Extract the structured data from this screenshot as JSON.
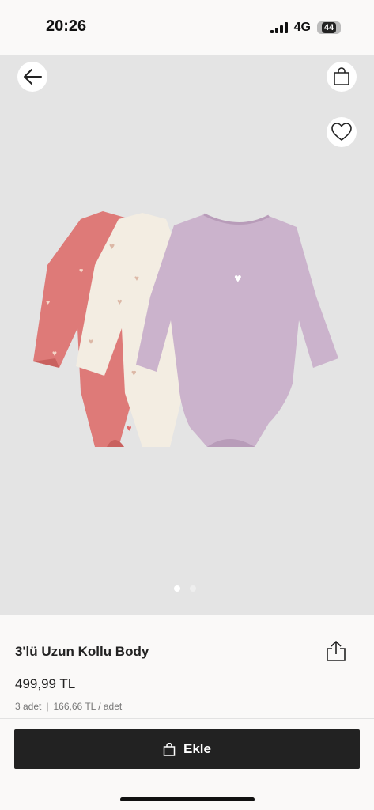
{
  "status": {
    "time": "20:26",
    "network": "4G",
    "battery": "44"
  },
  "colors": {
    "accent": "#222222",
    "gallery_bg": "#e4e4e4"
  },
  "gallery": {
    "image": "3 baby long sleeve bodysuits: pink, cream hearts, lilac",
    "total_images": 2,
    "active_index": 0
  },
  "product": {
    "name": "3'lü Uzun Kollu Body",
    "price": "499,99 TL",
    "quantity": "3 adet",
    "unit_price": "166,66 TL / adet"
  },
  "cta": {
    "label": "Ekle"
  },
  "icons": [
    "arrow-left-icon",
    "shopping-bag-icon",
    "heart-icon",
    "share-icon",
    "bag-icon"
  ]
}
